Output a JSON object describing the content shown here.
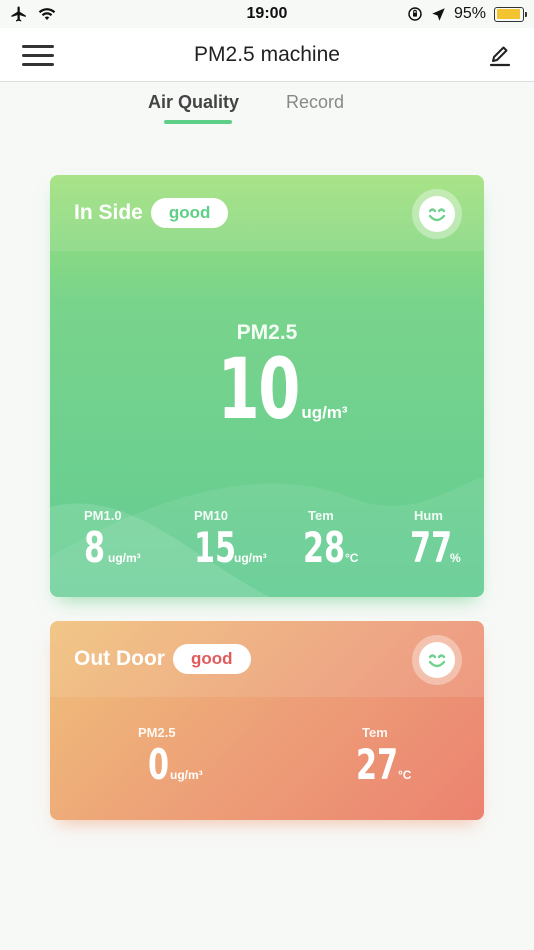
{
  "status_bar": {
    "time": "19:00",
    "battery_percent": "95%",
    "battery_level": 0.95,
    "icons": [
      "airplane-icon",
      "wifi-icon",
      "orientation-lock-icon",
      "location-icon",
      "battery-icon"
    ]
  },
  "nav": {
    "title": "PM2.5 machine",
    "icons": [
      "menu-icon",
      "edit-icon"
    ]
  },
  "tabs": [
    {
      "label": "Air Quality",
      "active": true
    },
    {
      "label": "Record",
      "active": false
    }
  ],
  "colors": {
    "accent_green": "#5ecf86",
    "badge_red": "#e25b5b",
    "indoor_card_top": "#9fe07a",
    "indoor_card_bottom": "#63cc93",
    "outdoor_card_left": "#f0c07a",
    "outdoor_card_right": "#ec8270"
  },
  "indoor": {
    "title": "In Side",
    "status": "good",
    "icon": "smiley-icon",
    "main": {
      "label": "PM2.5",
      "value": "10",
      "unit": "ug/m³"
    },
    "metrics": [
      {
        "label": "PM1.0",
        "value": "8",
        "unit": "ug/m³"
      },
      {
        "label": "PM10",
        "value": "15",
        "unit": "ug/m³"
      },
      {
        "label": "Tem",
        "value": "28",
        "unit": "°C"
      },
      {
        "label": "Hum",
        "value": "77",
        "unit": "%"
      }
    ]
  },
  "outdoor": {
    "title": "Out Door",
    "status": "good",
    "icon": "smiley-icon",
    "metrics": [
      {
        "label": "PM2.5",
        "value": "0",
        "unit": "ug/m³"
      },
      {
        "label": "Tem",
        "value": "27",
        "unit": "°C"
      }
    ]
  }
}
